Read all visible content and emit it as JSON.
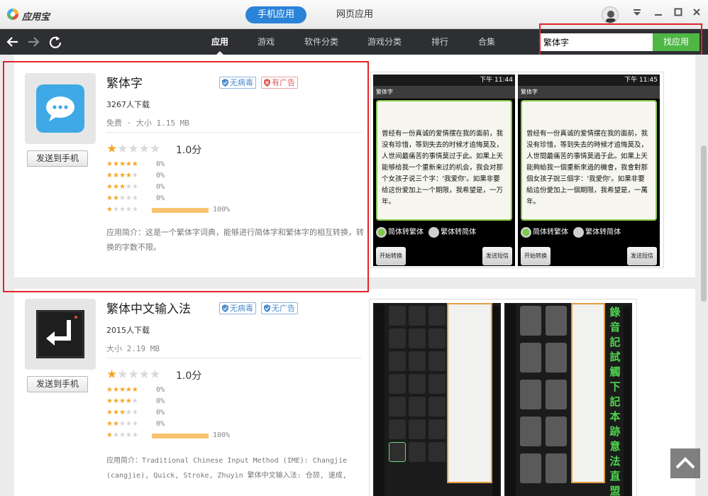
{
  "titlebar": {
    "app_title": "应用宝",
    "tabs": [
      {
        "label": "手机应用",
        "active": true
      },
      {
        "label": "网页应用",
        "active": false
      }
    ]
  },
  "navbar": {
    "tabs": [
      {
        "label": "应用",
        "active": true
      },
      {
        "label": "游戏",
        "active": false
      },
      {
        "label": "软件分类",
        "active": false
      },
      {
        "label": "游戏分类",
        "active": false
      },
      {
        "label": "排行",
        "active": false
      },
      {
        "label": "合集",
        "active": false
      }
    ],
    "search": {
      "value": "繁体字",
      "button": "找应用"
    }
  },
  "apps": [
    {
      "name": "繁体字",
      "badges": [
        {
          "label": "无病毒",
          "color": "blue"
        },
        {
          "label": "有广告",
          "color": "red"
        }
      ],
      "downloads": "3267人下载",
      "meta": "免费 · 大小 1.15 MB",
      "score": "1.0分",
      "score_stars": 1,
      "ratings": [
        {
          "stars": 5,
          "pct": "0%",
          "fraction": 0
        },
        {
          "stars": 4,
          "pct": "0%",
          "fraction": 0
        },
        {
          "stars": 3,
          "pct": "0%",
          "fraction": 0
        },
        {
          "stars": 2,
          "pct": "0%",
          "fraction": 0
        },
        {
          "stars": 1,
          "pct": "100%",
          "fraction": 1
        }
      ],
      "description": "应用简介：这是一个繁体字词典，能够进行简体字和繁体字的相互转换，转换的字数不限。",
      "send_button": "发送到手机",
      "screenshots": [
        {
          "status_time": "下午 11:44",
          "title": "繁体字",
          "text": "曾经有一份真诚的爱情摆在我的面前，我没有珍惜，等到失去的时候才追悔莫及，人世间最痛苦的事情莫过于此。如果上天能够给我一个重新来过的机会，我会对那个女孩子说三个字：'我爱你'。如果非要给这份爱加上一个期限，我希望是，一万年。",
          "radio1": "简体转繁体",
          "radio2": "繁体转简体",
          "btn_left": "开始转换",
          "btn_right": "发送短信"
        },
        {
          "status_time": "下午 11:45",
          "title": "繁体字",
          "text": "曾经有一份真诚的爱情摆在我的面前，我没有珍惜，等到失去的時候才追悔莫及，人世間最痛苦的事情莫過于此。如果上天能夠給我一個重新來過的機會，我會對那個女孩子說三個字：'我愛你'。如果非要給這份愛加上一個期限，我希望是，一萬年。",
          "radio1": "简体转繁体",
          "radio2": "繁体转简体",
          "btn_left": "开始转换",
          "btn_right": "发送短信"
        }
      ]
    },
    {
      "name": "繁体中文输入法",
      "badges": [
        {
          "label": "无病毒",
          "color": "blue"
        },
        {
          "label": "无广告",
          "color": "blue"
        }
      ],
      "downloads": "2015人下载",
      "meta": "大小 2.19 MB",
      "score": "1.0分",
      "score_stars": 1,
      "ratings": [
        {
          "stars": 5,
          "pct": "0%",
          "fraction": 0
        },
        {
          "stars": 4,
          "pct": "0%",
          "fraction": 0
        },
        {
          "stars": 3,
          "pct": "0%",
          "fraction": 0
        },
        {
          "stars": 2,
          "pct": "0%",
          "fraction": 0
        },
        {
          "stars": 1,
          "pct": "100%",
          "fraction": 1
        }
      ],
      "description": "应用简介：Traditional Chinese Input Method (IME): Changjie (cangjie), Quick, Stroke, Zhuyin 繁体中文输入法: 仓颉, 速成,",
      "send_button": "发送到手机",
      "keyboard_candidates": [
        "錄",
        "音",
        "記",
        "試",
        "觸",
        "下",
        "記",
        "本",
        "跡",
        "意",
        "法",
        "直",
        "盟"
      ]
    }
  ]
}
